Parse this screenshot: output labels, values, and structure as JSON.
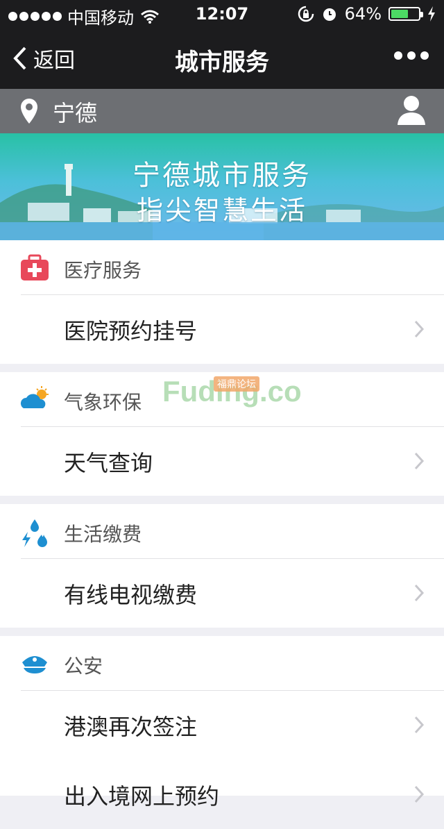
{
  "status": {
    "carrier": "中国移动",
    "time": "12:07",
    "battery": "64%",
    "battery_level": 0.64,
    "icons": [
      "signal-dots-icon",
      "wifi-icon",
      "rotation-lock-icon",
      "alarm-icon",
      "charging-icon"
    ]
  },
  "nav": {
    "back_label": "返回",
    "title": "城市服务",
    "more_icon": "more-icon"
  },
  "location": {
    "city": "宁德",
    "pin_icon": "location-pin-icon",
    "user_icon": "user-icon"
  },
  "banner": {
    "line1": "宁德城市服务",
    "line2": "指尖智慧生活"
  },
  "watermark": {
    "text": "Fuding.co",
    "sub": "福鼎论坛"
  },
  "sections": [
    {
      "title": "医疗服务",
      "icon": "medical-kit-icon",
      "icon_color": "#e8485a",
      "items": [
        "医院预约挂号"
      ]
    },
    {
      "title": "气象环保",
      "icon": "weather-icon",
      "icon_color": "#1e8fd1",
      "items": [
        "天气查询"
      ]
    },
    {
      "title": "生活缴费",
      "icon": "utilities-icon",
      "icon_color": "#1e8fd1",
      "items": [
        "有线电视缴费"
      ]
    },
    {
      "title": "公安",
      "icon": "police-cap-icon",
      "icon_color": "#1e8fd1",
      "items": [
        "港澳再次签注",
        "出入境网上预约"
      ]
    }
  ]
}
